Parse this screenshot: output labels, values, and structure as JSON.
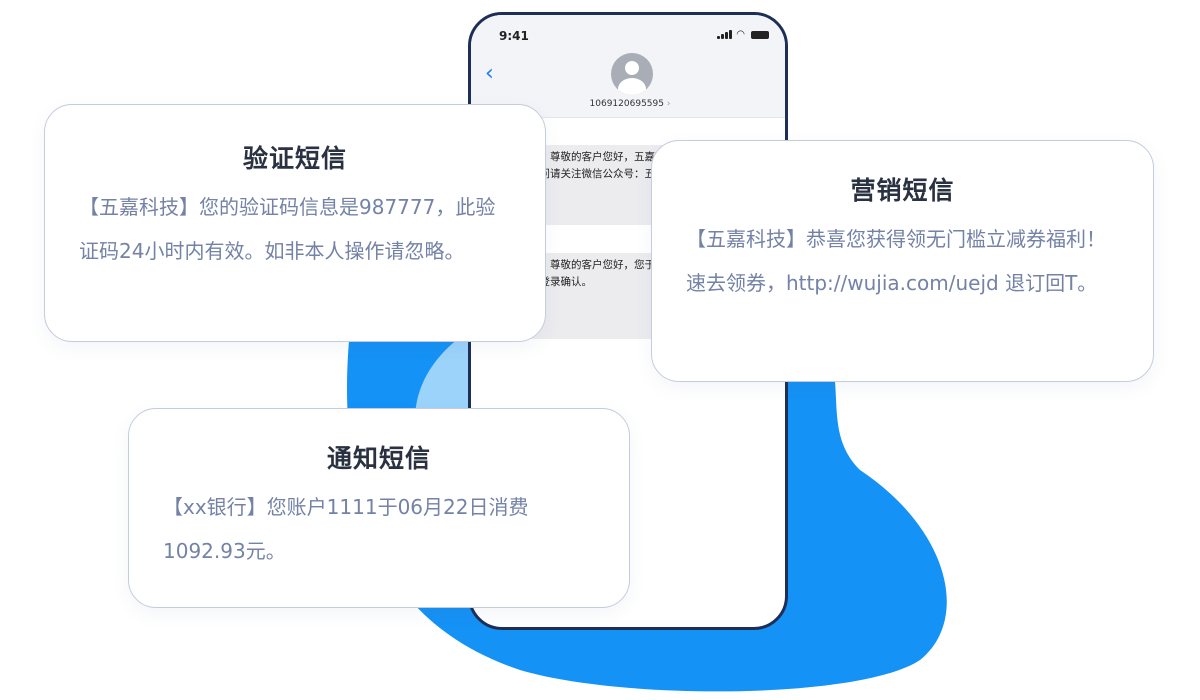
{
  "colors": {
    "blob_dark": "#1592f5",
    "blob_light": "#9bd3fb",
    "phone_frame": "#1d2f56",
    "card_border": "#c5cbe0",
    "title_text": "#2a3242",
    "body_text": "#7482a6"
  },
  "phone": {
    "status_time": "9:41",
    "contact_number": "1069120695595",
    "messages": [
      {
        "text": "【五嘉科技】尊敬的客户您好，五嘉科技将持续为您提供服务，如有疑问请关注微信公众号：五嘉科技"
      },
      {
        "text": "【五嘉科技】尊敬的客户您好，您于2020年的申请已通过审核，请及时登录确认。"
      }
    ]
  },
  "cards": {
    "verify": {
      "title": "验证短信",
      "body": "【五嘉科技】您的验证码信息是987777，此验证码24小时内有效。如非本人操作请忽略。"
    },
    "marketing": {
      "title": "营销短信",
      "body": "【五嘉科技】恭喜您获得领无门槛立减券福利！速去领券，http://wujia.com/uejd 退订回T。"
    },
    "notify": {
      "title": "通知短信",
      "body": "【xx银行】您账户1111于06月22日消费1092.93元。"
    }
  }
}
